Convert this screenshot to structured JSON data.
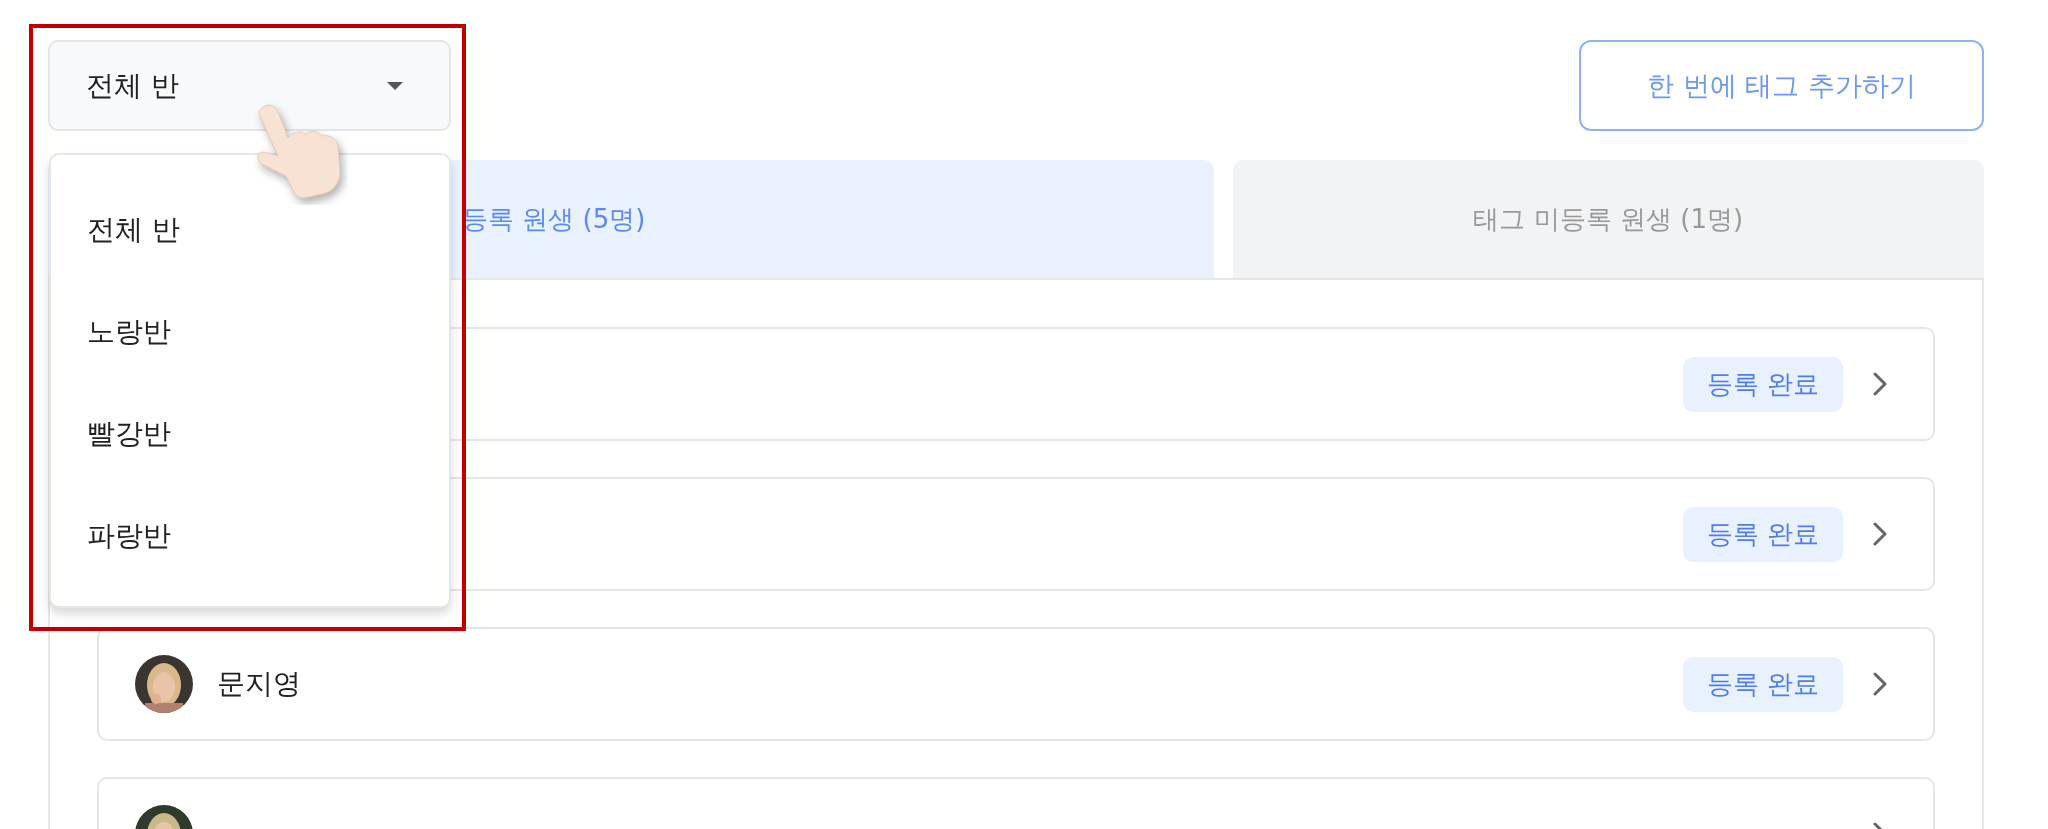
{
  "filter": {
    "value": "전체 반",
    "expanded": true
  },
  "menu": {
    "items": [
      {
        "label": "전체 반"
      },
      {
        "label": "노랑반"
      },
      {
        "label": "빨강반"
      },
      {
        "label": "파랑반"
      }
    ]
  },
  "add_tag_button": {
    "label": "한 번에 태그 추가하기"
  },
  "tabs": [
    {
      "label": "등록 원생 (5명)",
      "selected": true
    },
    {
      "label": "태그 미등록 원생 (1명)",
      "selected": false
    }
  ],
  "students": [
    {
      "status": "등록 완료"
    },
    {
      "status": "등록 완료"
    },
    {
      "name": "문지영",
      "status": "등록 완료",
      "avatar": {
        "kind": "picture"
      }
    },
    {
      "avatar": {
        "kind": "picture"
      }
    }
  ]
}
